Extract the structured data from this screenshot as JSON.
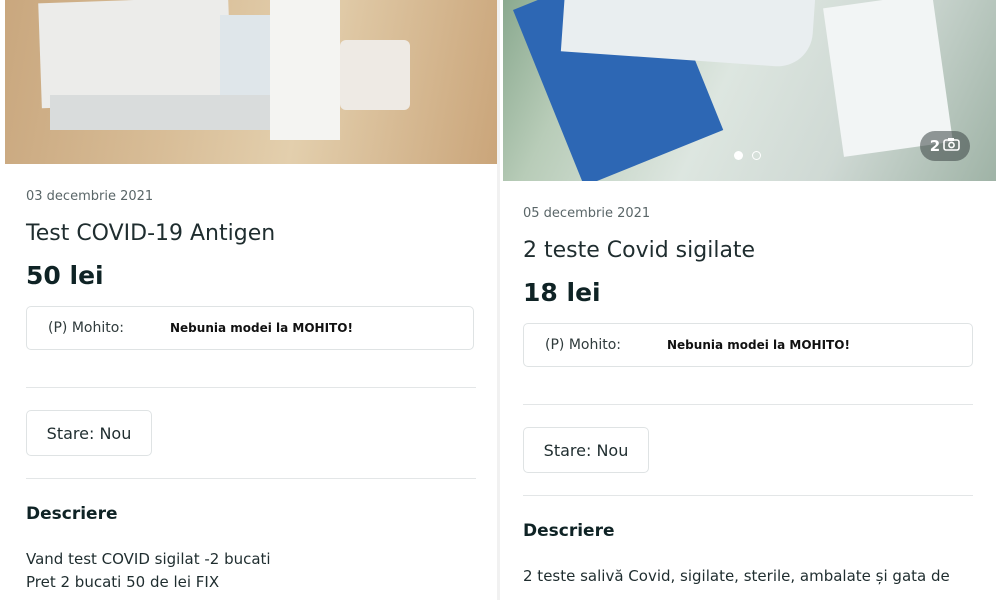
{
  "left": {
    "date": "03 decembrie 2021",
    "title": "Test COVID-19 Antigen",
    "price": "50 lei",
    "promo": {
      "label": "(P) Mohito:",
      "text": "Nebunia modei la MOHITO!"
    },
    "condition_label": "Stare: Nou",
    "description_heading": "Descriere",
    "description_lines": [
      "Vand test COVID sigilat -2 bucati",
      "Pret 2 bucati 50 de lei FIX"
    ]
  },
  "right": {
    "photo_counter": "2",
    "date": "05 decembrie 2021",
    "title": "2 teste Covid sigilate",
    "price": "18 lei",
    "promo": {
      "label": "(P) Mohito:",
      "text": "Nebunia modei la MOHITO!"
    },
    "condition_label": "Stare: Nou",
    "description_heading": "Descriere",
    "description_lines": [
      "2 teste salivă Covid, sigilate, sterile, ambalate și gata de"
    ]
  },
  "colors": {
    "text": "#1f2d2f",
    "border": "#dfe3e4",
    "divider": "#e3e6e7"
  },
  "icons": {
    "camera": "camera-icon"
  }
}
